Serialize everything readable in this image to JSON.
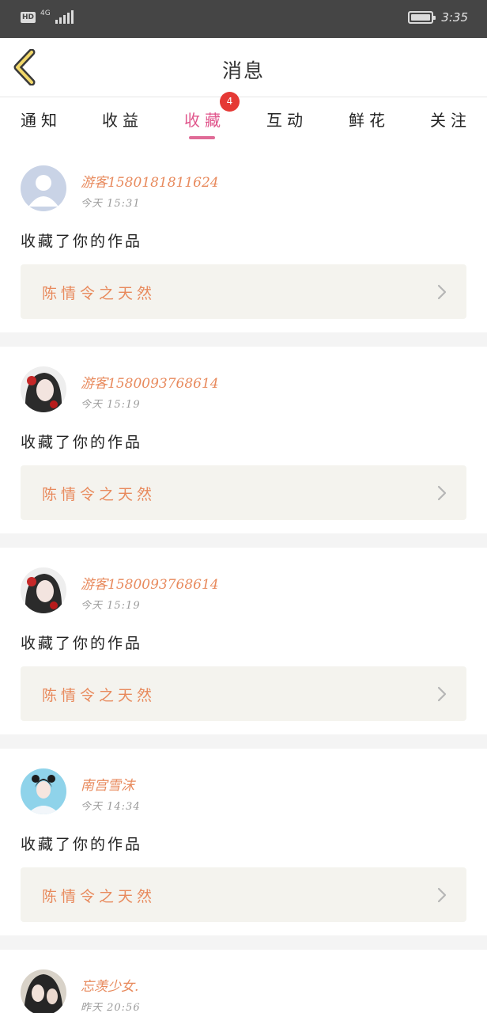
{
  "status_bar": {
    "hd": "HD",
    "network": "4G",
    "time": "3:35"
  },
  "header": {
    "title": "消息"
  },
  "tabs": [
    {
      "label": "通知",
      "active": false
    },
    {
      "label": "收益",
      "active": false
    },
    {
      "label": "收藏",
      "active": true,
      "badge": "4"
    },
    {
      "label": "互动",
      "active": false
    },
    {
      "label": "鲜花",
      "active": false
    },
    {
      "label": "关注",
      "active": false
    }
  ],
  "colors": {
    "accent_pink": "#e0568c",
    "name_orange": "#e88a5d",
    "badge_red": "#e53935",
    "work_bg": "#f4f3ee"
  },
  "feed": [
    {
      "username": "游客1580181811624",
      "time": "今天 15:31",
      "action": "收藏了你的作品",
      "work": "陈情令之天然",
      "avatar": "default-avatar-icon"
    },
    {
      "username": "游客1580093768614",
      "time": "今天 15:19",
      "action": "收藏了你的作品",
      "work": "陈情令之天然",
      "avatar": "user-avatar"
    },
    {
      "username": "游客1580093768614",
      "time": "今天 15:19",
      "action": "收藏了你的作品",
      "work": "陈情令之天然",
      "avatar": "user-avatar"
    },
    {
      "username": "南宫雪沫",
      "time": "今天 14:34",
      "action": "收藏了你的作品",
      "work": "陈情令之天然",
      "avatar": "user-avatar"
    },
    {
      "username": "忘羡少女.",
      "time": "昨天 20:56",
      "avatar": "user-avatar"
    }
  ]
}
